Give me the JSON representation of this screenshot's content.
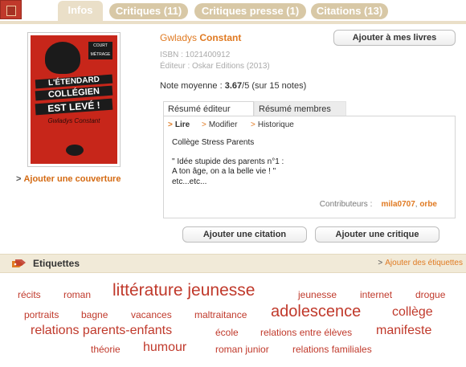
{
  "tabs": [
    {
      "label": "Infos",
      "active": true
    },
    {
      "label": "Critiques (11)",
      "active": false
    },
    {
      "label": "Critiques presse (1)",
      "active": false
    },
    {
      "label": "Citations (13)",
      "active": false
    }
  ],
  "cover": {
    "sticker": "COURT MÉTRAGE",
    "line1": "L'ÉTENDARD",
    "line2": "COLLÉGIEN",
    "line3": "EST LEVÉ !",
    "signature": "Gwladys Constant",
    "add_cover_label": "Ajouter une couverture"
  },
  "book": {
    "author_first": "Gwladys",
    "author_last": "Constant",
    "isbn": "ISBN : 1021400912",
    "editeur": "Éditeur : Oskar Editions (2013)",
    "note_label": "Note moyenne :",
    "note_value": "3.67",
    "note_suffix": "/5 (sur 15 notes)",
    "add_to_library": "Ajouter à mes livres"
  },
  "resume": {
    "tabs": [
      "Résumé éditeur",
      "Résumé membres"
    ],
    "links": [
      "Lire",
      "Modifier",
      "Historique"
    ],
    "lines": [
      "Collège Stress Parents",
      "\" Idée stupide des parents n°1 :",
      "A ton âge, on a la belle vie ! \"",
      "etc...etc..."
    ],
    "contrib_label": "Contributeurs :",
    "contrib_user1": "mila0707",
    "contrib_sep": ",",
    "contrib_user2": "orbe"
  },
  "actions": {
    "add_citation": "Ajouter une citation",
    "add_critique": "Ajouter une critique"
  },
  "etiquettes": {
    "title": "Etiquettes",
    "add_label": "Ajouter des étiquettes",
    "tags": [
      "récits",
      "roman",
      "littérature jeunesse",
      "jeunesse",
      "internet",
      "drogue",
      "portraits",
      "bagne",
      "vacances",
      "maltraitance",
      "adolescence",
      "collège",
      "relations parents-enfants",
      "école",
      "relations entre élèves",
      "manifeste",
      "théorie",
      "humour",
      "roman junior",
      "relations familiales"
    ]
  },
  "colors": {
    "accent": "#e07a22",
    "tag": "#c0392b",
    "tab": "#d8c8a6"
  }
}
